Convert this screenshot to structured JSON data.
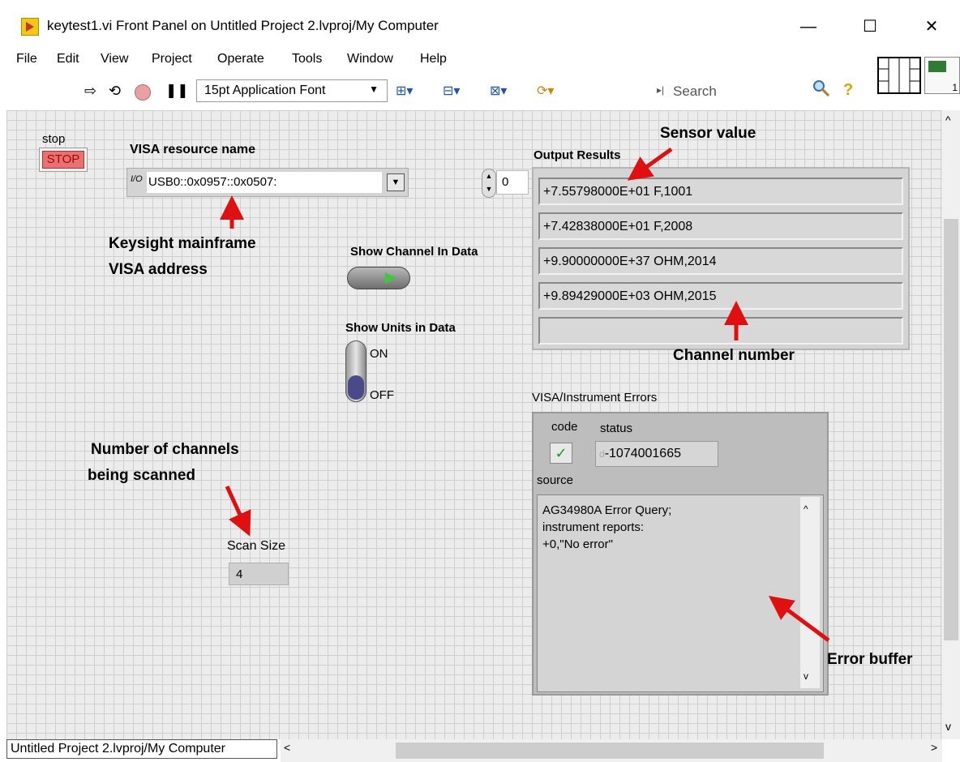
{
  "window": {
    "title": "keytest1.vi Front Panel on Untitled Project 2.lvproj/My Computer",
    "minimize": "—",
    "maximize": "☐",
    "close": "✕"
  },
  "menu": [
    "File",
    "Edit",
    "View",
    "Project",
    "Operate",
    "Tools",
    "Window",
    "Help"
  ],
  "toolbar": {
    "font": "15pt Application Font",
    "search_placeholder": "Search",
    "help": "?",
    "connector_num": "1"
  },
  "panel": {
    "stop_label": "stop",
    "stop_button": "STOP",
    "visa_label": "VISA resource name",
    "visa_prefix": "I/O",
    "visa_value": "USB0::0x0957::0x0507:",
    "index_value": "0",
    "output_label": "Output Results",
    "output_rows": [
      "+7.55798000E+01  F,1001",
      "+7.42838000E+01  F,2008",
      "+9.90000000E+37 OHM,2014",
      "+9.89429000E+03 OHM,2015",
      ""
    ],
    "show_channel_label": "Show Channel In Data",
    "show_units_label": "Show Units in Data",
    "switch_on": "ON",
    "switch_off": "OFF",
    "errors_label": "VISA/Instrument Errors",
    "code_label": "code",
    "status_label": "status",
    "status_value": "-1074001665",
    "status_prefix": "d",
    "source_label": "source",
    "source_text": "AG34980A Error Query;\ninstrument reports:\n+0,\"No error\"",
    "scan_size_label": "Scan Size",
    "scan_size_value": "4"
  },
  "annotations": {
    "sensor_value": "Sensor value",
    "keysight_line1": "Keysight mainframe",
    "keysight_line2": "VISA address",
    "channel_number": "Channel number",
    "num_channels_line1": "Number of channels",
    "num_channels_line2": "being scanned",
    "error_buffer": "Error buffer"
  },
  "status_bar": {
    "path": "Untitled Project 2.lvproj/My Computer"
  },
  "colors": {
    "annotation_arrow": "#e01010",
    "stop_button": "#e57373",
    "led_on": "#3ec63e"
  }
}
